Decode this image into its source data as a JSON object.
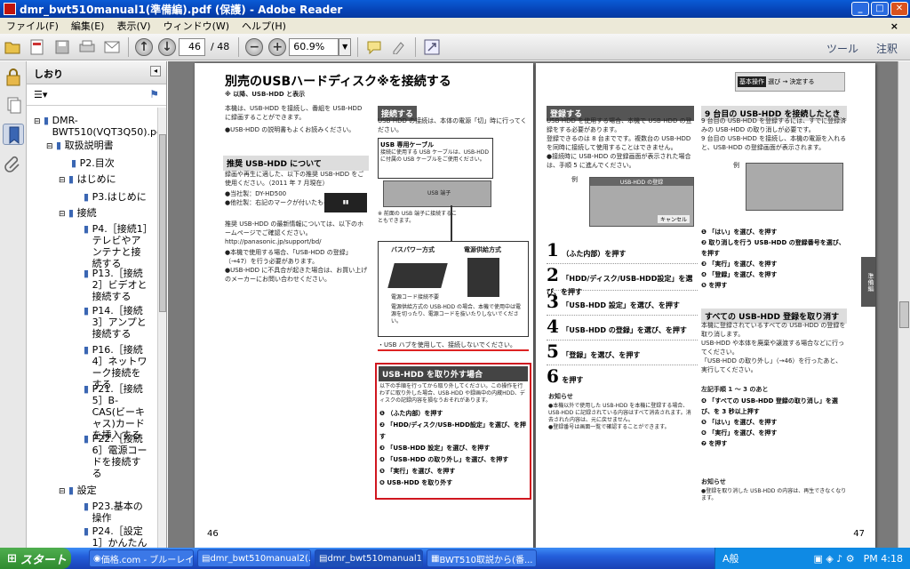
{
  "window": {
    "title": "dmr_bwt510manual1(準備編).pdf (保護) - Adobe Reader"
  },
  "menu": [
    "ファイル(F)",
    "編集(E)",
    "表示(V)",
    "ウィンドウ(W)",
    "ヘルプ(H)"
  ],
  "toolbar": {
    "page_current": "46",
    "page_total": "/ 48",
    "zoom": "60.9%",
    "tools_label": "ツール",
    "comment_label": "注釈"
  },
  "sidebar": {
    "title": "しおり",
    "tree": [
      {
        "label": "DMR-BWT510(VQT3Q50).pdf"
      },
      {
        "label": "取扱説明書"
      },
      {
        "label": "P2.目次"
      },
      {
        "label": "はじめに"
      },
      {
        "label": "P3.はじめに"
      },
      {
        "label": "接続"
      },
      {
        "label": "P4.［接続1］テレビやアンテナと接続する"
      },
      {
        "label": "P13.［接続2］ビデオと接続する"
      },
      {
        "label": "P14.［接続3］アンプと接続する"
      },
      {
        "label": "P16.［接続4］ネットワーク接続をする"
      },
      {
        "label": "P21.［接続5］B-CAS(ビーキャス)カードを挿入する"
      },
      {
        "label": "P22.［接続6］電源コードを接続する"
      },
      {
        "label": "設定"
      },
      {
        "label": "P23.基本の操作"
      },
      {
        "label": "P24.［設定1］かんたん"
      }
    ]
  },
  "page_left": {
    "title": "別売のUSBハードディスク※を接続する",
    "sub": "※ 以降、USB-HDD と表示",
    "intro": "本機は、USB-HDD を接続し、番組を USB-HDD に録画することができます。",
    "intro2": "●USB-HDD の説明書もよくお読みください。",
    "recommended_title": "推奨 USB-HDD について",
    "recommended_body": "録画や再生に適した、以下の推奨 USB-HDD をご使用ください。（2011 年 7 月現在）",
    "rec_list": "●当社製：DY-HD500\n●他社製：右記のマークが付いたもの",
    "url_text": "推奨 USB-HDD の最新情報については、以下のホームページでご確認ください。\nhttp://panasonic.jp/support/bd/",
    "notes": "●本機で使用する場合、「USB-HDD の登録」（→47）を行う必要があります。\n●USB-HDD に不具合が起きた場合は、お買い上げのメーカーにお問い合わせください。",
    "connect_title": "接続する",
    "connect_body": "USB-HDD の接続は、本体の電源「切」時に行ってください。",
    "cable_title": "USB 専用ケーブル",
    "cable_body": "接続に使用する USB ケーブルは、USB-HDD に付属の USB ケーブルをご使用ください。",
    "usb_port_label": "USB 端子",
    "front_note": "※ 前面の USB 端子に接続することもできます。",
    "bus_power": "バスパワー方式",
    "ac_power": "電源供給方式",
    "no_ac": "電源コード接続不要",
    "power_note": "電源供給方式の USB-HDD の場合、本機で使用中は電源を切ったり、電源コードを抜いたりしないでください。",
    "hub_warning": "・USB ハブを使用して、接続しないでください。",
    "remove_title": "USB-HDD を取り外す場合",
    "remove_body": "以下の手順を行ってから取り外してください。この操作を行わずに取り外した場合、USB-HDD や録画中の内蔵HDD、ディスクの記録内容を損なうおそれがあります。",
    "remove_steps": [
      "（ふた内部）を押す",
      "「HDD/ディスク/USB-HDD設定」を選び、を押す",
      "「USB-HDD 設定」を選び、を押す",
      "「USB-HDD の取り外し」を選び、を押す",
      "「実行」を選び、を押す",
      "USB-HDD を取り外す"
    ],
    "page_number": "46"
  },
  "page_right": {
    "basic_op": "基本操作",
    "basic_op_hint": "選び → 決定する",
    "register_title": "登録する",
    "register_body": "USB-HDD を使用する場合、本機で USB-HDD の登録をする必要があります。\n登録できるのは 8 台までです。複数台の USB-HDD を同時に接続して使用することはできません。\n●接続時に USB-HDD の登録画面が表示された場合は、手順 5 に進んでください。",
    "example": "例",
    "screen_title": "USB-HDD の登録",
    "screen_cancel": "キャンセル",
    "steps": [
      {
        "n": "1",
        "t": "（ふた内部）を押す"
      },
      {
        "n": "2",
        "t": "「HDD/ディスク/USB-HDD設定」を選び、を押す"
      },
      {
        "n": "3",
        "t": "「USB-HDD 設定」を選び、を押す"
      },
      {
        "n": "4",
        "t": "「USB-HDD の登録」を選び、を押す"
      },
      {
        "n": "5",
        "t": "「登録」を選び、を押す"
      },
      {
        "n": "6",
        "t": "を押す"
      }
    ],
    "notice_title": "お知らせ",
    "notice_body": "●本機以外で使用した USB-HDD を本機に登録する場合、USB-HDD に記録されている内容はすべて消去されます。消去された内容は、元に戻せません。\n●登録番号は画面一覧で確認することができます。",
    "ninth_title": "9 台目の USB-HDD を接続したとき",
    "ninth_body": "9 台目の USB-HDD を登録するには、すでに登録済みの USB-HDD の取り消しが必要です。\n9 台目の USB-HDD を接続し、本機の電源を入れると、USB-HDD の登録画面が表示されます。",
    "ninth_steps": [
      "「はい」を選び、を押す",
      "取り消しを行う USB-HDD の登録番号を選び、を押す",
      "「実行」を選び、を押す",
      "「登録」を選び、を押す",
      "を押す"
    ],
    "cancel_all_title": "すべての USB-HDD 登録を取り消す",
    "cancel_all_body": "本機に登録されているすべての USB-HDD の登録を取り消します。\nUSB-HDD や本体を廃棄や譲渡する場合などに行ってください。\n「USB-HDD の取り外し」（→46）を行ったあと、実行してください。",
    "left_steps_label": "左記手順 1 〜 3 のあと",
    "cancel_steps": [
      "「すべての USB-HDD 登録の取り消し」を選び、を 3 秒以上押す",
      "「はい」を選び、を押す",
      "「実行」を選び、を押す",
      "を押す"
    ],
    "notice2_body": "●登録を取り消した USB-HDD の内容は、再生できなくなります。",
    "side_tab": "準備編",
    "page_number": "47"
  },
  "taskbar": {
    "start": "スタート",
    "tasks": [
      "価格.com - ブルーレイ...",
      "dmr_bwt510manual2(...",
      "dmr_bwt510manual1(...",
      "BWT510取説から(番..."
    ],
    "clock": "PM 4:18",
    "ime": "A般"
  }
}
